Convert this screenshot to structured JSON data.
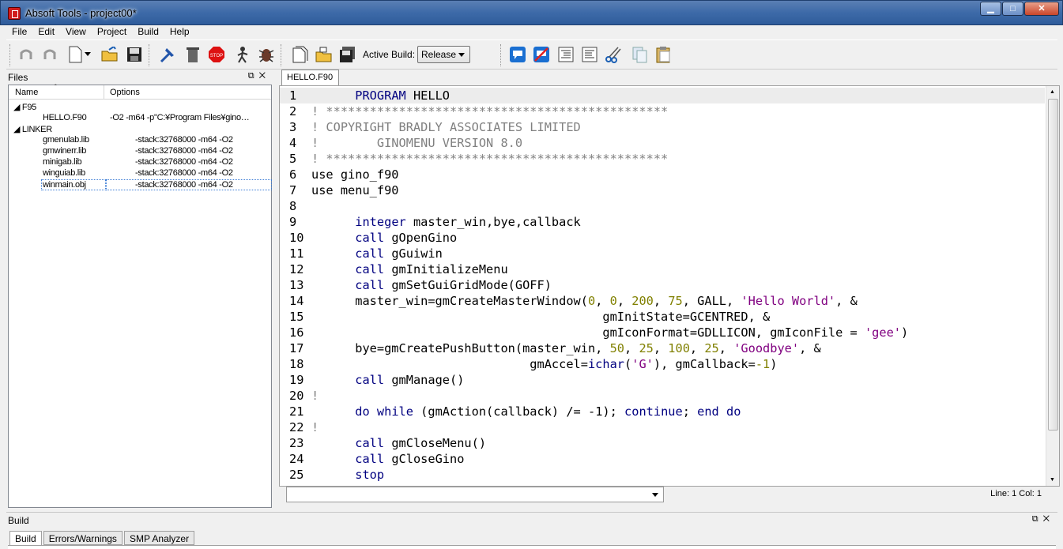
{
  "window": {
    "title": "Absoft Tools - project00*",
    "controls": [
      "minimize-icon",
      "maximize-icon",
      "close-icon"
    ]
  },
  "menu": [
    "File",
    "Edit",
    "View",
    "Project",
    "Build",
    "Help"
  ],
  "toolbar": {
    "active_build_label": "Active Build:",
    "active_build_value": "Release",
    "icons": [
      "undo-icon",
      "redo-icon",
      "new-file-icon",
      "open-folder-icon",
      "save-icon",
      "build-hammer-icon",
      "trash-icon",
      "stop-icon",
      "run-icon",
      "debug-icon",
      "new-project-icon",
      "open-project-icon",
      "save-all-icon",
      "comment-icon",
      "uncomment-icon",
      "indent-icon",
      "outdent-icon",
      "cut-icon",
      "copy-icon",
      "paste-icon"
    ]
  },
  "files_panel": {
    "title": "Files",
    "columns": [
      "Name",
      "Options"
    ],
    "groups": [
      {
        "label": "F95",
        "items": [
          {
            "name": "HELLO.F90",
            "options": "-O2 -m64 -p\"C:¥Program Files¥gino…"
          }
        ]
      },
      {
        "label": "LINKER",
        "items": [
          {
            "name": "gmenulab.lib",
            "options": "-stack:32768000 -m64 -O2"
          },
          {
            "name": "gmwinerr.lib",
            "options": "-stack:32768000 -m64 -O2"
          },
          {
            "name": "minigab.lib",
            "options": "-stack:32768000 -m64 -O2"
          },
          {
            "name": "winguiab.lib",
            "options": "-stack:32768000 -m64 -O2"
          },
          {
            "name": "winmain.obj",
            "options": "-stack:32768000 -m64 -O2"
          }
        ]
      }
    ]
  },
  "editor": {
    "tab": "HELLO.F90",
    "status": "Line: 1 Col: 1",
    "lines": [
      {
        "n": "1",
        "t": "      PROGRAM HELLO"
      },
      {
        "n": "2",
        "t": "! ***********************************************"
      },
      {
        "n": "3",
        "t": "! COPYRIGHT BRADLY ASSOCIATES LIMITED"
      },
      {
        "n": "4",
        "t": "!        GINOMENU VERSION 8.0"
      },
      {
        "n": "5",
        "t": "! ***********************************************"
      },
      {
        "n": "6",
        "t": "use gino_f90"
      },
      {
        "n": "7",
        "t": "use menu_f90"
      },
      {
        "n": "8",
        "t": ""
      },
      {
        "n": "9",
        "t": "      integer master_win,bye,callback"
      },
      {
        "n": "10",
        "t": "      call gOpenGino"
      },
      {
        "n": "11",
        "t": "      call gGuiwin"
      },
      {
        "n": "12",
        "t": "      call gmInitializeMenu"
      },
      {
        "n": "13",
        "t": "      call gmSetGuiGridMode(GOFF)"
      },
      {
        "n": "14",
        "t": "      master_win=gmCreateMasterWindow(0, 0, 200, 75, GALL, 'Hello World', &"
      },
      {
        "n": "15",
        "t": "                                        gmInitState=GCENTRED, &"
      },
      {
        "n": "16",
        "t": "                                        gmIconFormat=GDLLICON, gmIconFile = 'gee')"
      },
      {
        "n": "17",
        "t": "      bye=gmCreatePushButton(master_win, 50, 25, 100, 25, 'Goodbye', &"
      },
      {
        "n": "18",
        "t": "                              gmAccel=ichar('G'), gmCallback=-1)"
      },
      {
        "n": "19",
        "t": "      call gmManage()"
      },
      {
        "n": "20",
        "t": "!"
      },
      {
        "n": "21",
        "t": "      do while (gmAction(callback) /= -1); continue; end do"
      },
      {
        "n": "22",
        "t": "!"
      },
      {
        "n": "23",
        "t": "      call gmCloseMenu()"
      },
      {
        "n": "24",
        "t": "      call gCloseGino"
      },
      {
        "n": "25",
        "t": "      stop"
      }
    ]
  },
  "build_panel": {
    "title": "Build",
    "tabs": [
      "Build",
      "Errors/Warnings",
      "SMP Analyzer"
    ]
  }
}
